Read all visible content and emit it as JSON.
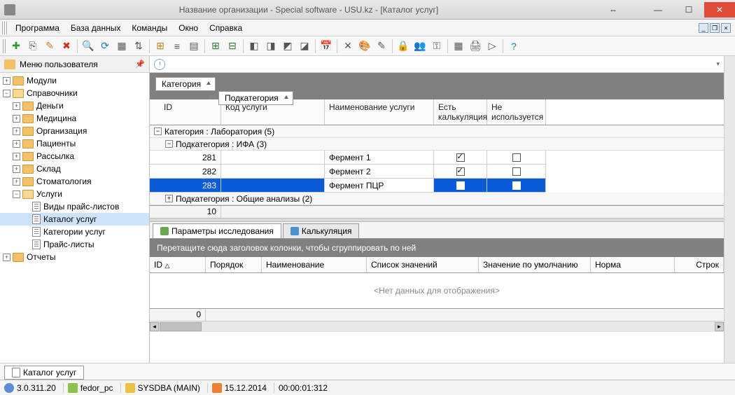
{
  "window": {
    "title": "Название организации - Special software - USU.kz - [Каталог услуг]"
  },
  "menu": {
    "program": "Программа",
    "database": "База данных",
    "commands": "Команды",
    "window": "Окно",
    "help": "Справка"
  },
  "sidebar": {
    "title": "Меню пользователя",
    "modules": "Модули",
    "directories": "Справочники",
    "money": "Деньги",
    "medicine": "Медицина",
    "organization": "Организация",
    "patients": "Пациенты",
    "mailing": "Рассылка",
    "warehouse": "Склад",
    "stomatology": "Стоматология",
    "services": "Услуги",
    "price_types": "Виды прайс-листов",
    "catalog": "Каталог услуг",
    "categories": "Категории услуг",
    "price_lists": "Прайс-листы",
    "reports": "Отчеты"
  },
  "group_chips": {
    "category": "Категория",
    "subcategory": "Подкатегория"
  },
  "grid": {
    "headers": {
      "id": "ID",
      "code": "Код услуги",
      "name": "Наименование услуги",
      "calc": "Есть калькуляция",
      "unused": "Не используется"
    },
    "group_lab": "Категория : Лаборатория (5)",
    "group_ifa": "Подкатегория : ИФА (3)",
    "group_common": "Подкатегория : Общие анализы (2)",
    "rows": [
      {
        "id": "281",
        "name": "Фермент 1",
        "calc": true,
        "unused": false
      },
      {
        "id": "282",
        "name": "Фермент 2",
        "calc": true,
        "unused": false
      },
      {
        "id": "283",
        "name": "Фермент ПЦР",
        "calc": false,
        "unused": false
      }
    ],
    "footer_count": "10"
  },
  "bottom_tabs": {
    "params": "Параметры исследования",
    "calc": "Калькуляция"
  },
  "bottom": {
    "drop_hint": "Перетащите сюда заголовок колонки, чтобы сгруппировать по ней",
    "headers": {
      "id": "ID",
      "order": "Порядок",
      "name": "Наименование",
      "values": "Список значений",
      "default": "Значение по умолчанию",
      "norm": "Норма",
      "rows": "Строк"
    },
    "no_data": "<Нет данных для отображения>",
    "footer_count": "0"
  },
  "doctab": "Каталог услуг",
  "status": {
    "version": "3.0.311.20",
    "host": "fedor_pc",
    "user": "SYSDBA (MAIN)",
    "date": "15.12.2014",
    "time": "00:00:01:312"
  }
}
